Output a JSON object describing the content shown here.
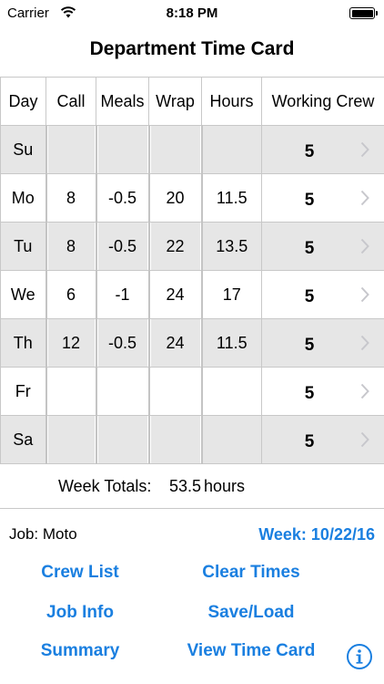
{
  "status_bar": {
    "carrier": "Carrier",
    "time": "8:18 PM",
    "icons": [
      "wifi-icon",
      "battery-icon"
    ]
  },
  "title": "Department Time Card",
  "table": {
    "headers": [
      "Day",
      "Call",
      "Meals",
      "Wrap",
      "Hours",
      "Working Crew"
    ],
    "rows": [
      {
        "day": "Su",
        "call": "",
        "meals": "",
        "wrap": "",
        "hours": "",
        "crew": "5"
      },
      {
        "day": "Mo",
        "call": "8",
        "meals": "-0.5",
        "wrap": "20",
        "hours": "11.5",
        "crew": "5"
      },
      {
        "day": "Tu",
        "call": "8",
        "meals": "-0.5",
        "wrap": "22",
        "hours": "13.5",
        "crew": "5"
      },
      {
        "day": "We",
        "call": "6",
        "meals": "-1",
        "wrap": "24",
        "hours": "17",
        "crew": "5"
      },
      {
        "day": "Th",
        "call": "12",
        "meals": "-0.5",
        "wrap": "24",
        "hours": "11.5",
        "crew": "5"
      },
      {
        "day": "Fr",
        "call": "",
        "meals": "",
        "wrap": "",
        "hours": "",
        "crew": "5"
      },
      {
        "day": "Sa",
        "call": "",
        "meals": "",
        "wrap": "",
        "hours": "",
        "crew": "5"
      }
    ]
  },
  "totals": {
    "label": "Week Totals:",
    "value": "53.5",
    "unit": "hours"
  },
  "job_label": "Job: Moto",
  "week_label": "Week: 10/22/16",
  "buttons": {
    "crew_list": "Crew List",
    "clear_times": "Clear Times",
    "job_info": "Job Info",
    "save_load": "Save/Load",
    "summary": "Summary",
    "view_time_card": "View Time Card"
  },
  "colors": {
    "accent": "#1a7fe0",
    "shaded_row": "#e6e6e6",
    "chevron": "#c7c7cc"
  }
}
